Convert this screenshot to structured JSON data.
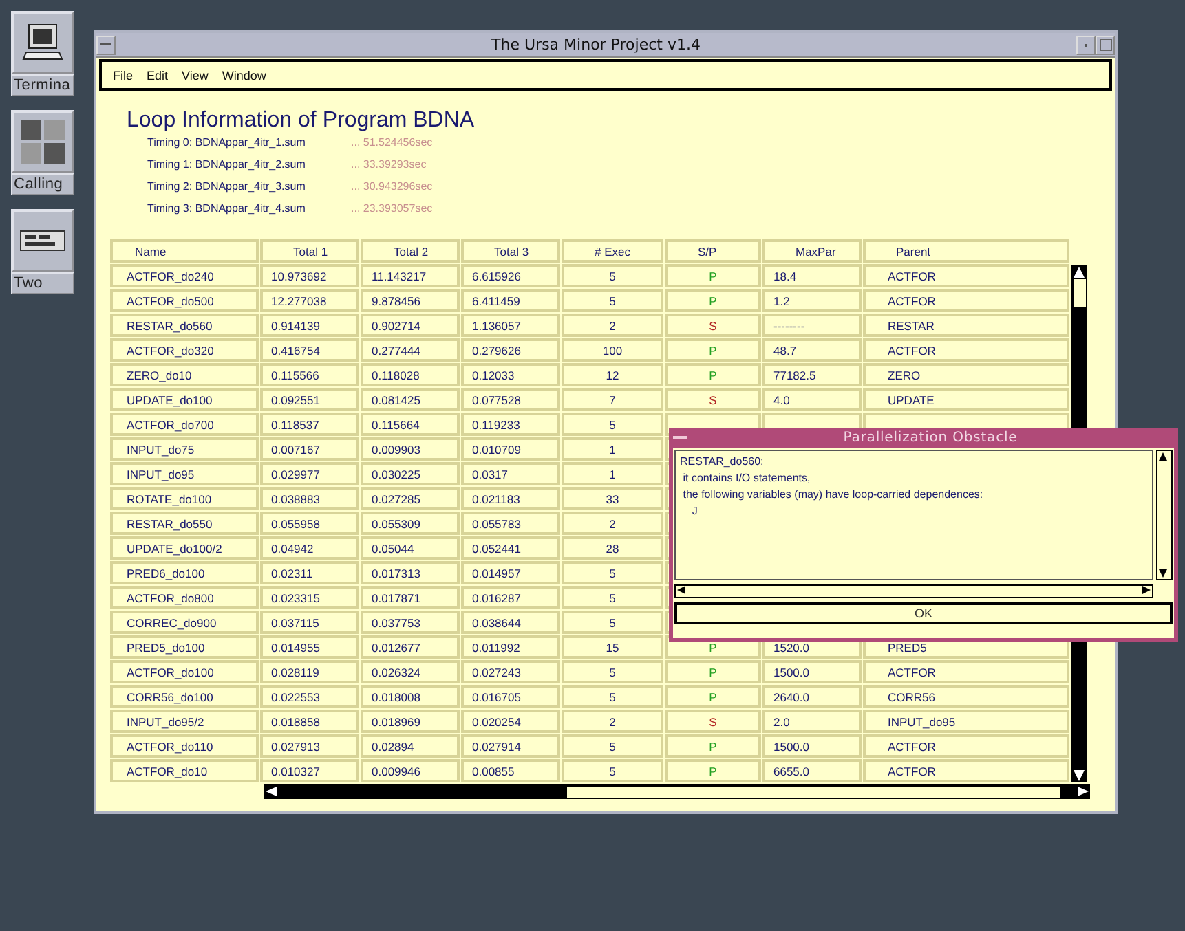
{
  "desktop_icons": [
    {
      "label": "Termina",
      "kind": "terminal"
    },
    {
      "label": "Calling",
      "kind": "grid"
    },
    {
      "label": "Two",
      "kind": "panel"
    }
  ],
  "window": {
    "title": "The Ursa Minor Project v1.4"
  },
  "menu": [
    "File",
    "Edit",
    "View",
    "Window"
  ],
  "heading": "Loop Information of Program BDNA",
  "timings": [
    {
      "label": "Timing 0: BDNAppar_4itr_1.sum",
      "value": "... 51.524456sec"
    },
    {
      "label": "Timing 1: BDNAppar_4itr_2.sum",
      "value": "... 33.39293sec"
    },
    {
      "label": "Timing 2: BDNAppar_4itr_3.sum",
      "value": "... 30.943296sec"
    },
    {
      "label": "Timing 3: BDNAppar_4itr_4.sum",
      "value": "... 23.393057sec"
    }
  ],
  "table": {
    "columns": [
      "Name",
      "Total 1",
      "Total 2",
      "Total 3",
      "# Exec",
      "S/P",
      "MaxPar",
      "Parent"
    ],
    "rows": [
      {
        "name": "ACTFOR_do240",
        "total1": "10.973692",
        "total2": "11.143217",
        "total3": "6.615926",
        "exec": "5",
        "sp": "P",
        "color": "#22a022",
        "maxpar": "18.4",
        "parent": "ACTFOR"
      },
      {
        "name": "ACTFOR_do500",
        "total1": "12.277038",
        "total2": "9.878456",
        "total3": "6.411459",
        "exec": "5",
        "sp": "P",
        "color": "#22a022",
        "maxpar": "1.2",
        "parent": "ACTFOR"
      },
      {
        "name": "RESTAR_do560",
        "total1": "0.914139",
        "total2": "0.902714",
        "total3": "1.136057",
        "exec": "2",
        "sp": "S",
        "color": "#b02020",
        "maxpar": "--------",
        "parent": "RESTAR"
      },
      {
        "name": "ACTFOR_do320",
        "total1": "0.416754",
        "total2": "0.277444",
        "total3": "0.279626",
        "exec": "100",
        "sp": "P",
        "color": "#22a022",
        "maxpar": "48.7",
        "parent": "ACTFOR"
      },
      {
        "name": "ZERO_do10",
        "total1": "0.115566",
        "total2": "0.118028",
        "total3": "0.12033",
        "exec": "12",
        "sp": "P",
        "color": "#22a022",
        "maxpar": "77182.5",
        "parent": "ZERO"
      },
      {
        "name": "UPDATE_do100",
        "total1": "0.092551",
        "total2": "0.081425",
        "total3": "0.077528",
        "exec": "7",
        "sp": "S",
        "color": "#b02020",
        "maxpar": "4.0",
        "parent": "UPDATE"
      },
      {
        "name": "ACTFOR_do700",
        "total1": "0.118537",
        "total2": "0.115664",
        "total3": "0.119233",
        "exec": "5"
      },
      {
        "name": "INPUT_do75",
        "total1": "0.007167",
        "total2": "0.009903",
        "total3": "0.010709",
        "exec": "1"
      },
      {
        "name": "INPUT_do95",
        "total1": "0.029977",
        "total2": "0.030225",
        "total3": "0.0317",
        "exec": "1"
      },
      {
        "name": "ROTATE_do100",
        "total1": "0.038883",
        "total2": "0.027285",
        "total3": "0.021183",
        "exec": "33"
      },
      {
        "name": "RESTAR_do550",
        "total1": "0.055958",
        "total2": "0.055309",
        "total3": "0.055783",
        "exec": "2"
      },
      {
        "name": "UPDATE_do100/2",
        "total1": "0.04942",
        "total2": "0.05044",
        "total3": "0.052441",
        "exec": "28"
      },
      {
        "name": "PRED6_do100",
        "total1": "0.02311",
        "total2": "0.017313",
        "total3": "0.014957",
        "exec": "5"
      },
      {
        "name": "ACTFOR_do800",
        "total1": "0.023315",
        "total2": "0.017871",
        "total3": "0.016287",
        "exec": "5"
      },
      {
        "name": "CORREC_do900",
        "total1": "0.037115",
        "total2": "0.037753",
        "total3": "0.038644",
        "exec": "5"
      },
      {
        "name": "PRED5_do100",
        "total1": "0.014955",
        "total2": "0.012677",
        "total3": "0.011992",
        "exec": "15",
        "sp": "P",
        "color": "#22a022",
        "maxpar": "1520.0",
        "parent": "PRED5"
      },
      {
        "name": "ACTFOR_do100",
        "total1": "0.028119",
        "total2": "0.026324",
        "total3": "0.027243",
        "exec": "5",
        "sp": "P",
        "color": "#22a022",
        "maxpar": "1500.0",
        "parent": "ACTFOR"
      },
      {
        "name": "CORR56_do100",
        "total1": "0.022553",
        "total2": "0.018008",
        "total3": "0.016705",
        "exec": "5",
        "sp": "P",
        "color": "#22a022",
        "maxpar": "2640.0",
        "parent": "CORR56"
      },
      {
        "name": "INPUT_do95/2",
        "total1": "0.018858",
        "total2": "0.018969",
        "total3": "0.020254",
        "exec": "2",
        "sp": "S",
        "color": "#b02020",
        "maxpar": "2.0",
        "parent": "INPUT_do95"
      },
      {
        "name": "ACTFOR_do110",
        "total1": "0.027913",
        "total2": "0.02894",
        "total3": "0.027914",
        "exec": "5",
        "sp": "P",
        "color": "#22a022",
        "maxpar": "1500.0",
        "parent": "ACTFOR"
      },
      {
        "name": "ACTFOR_do10",
        "total1": "0.010327",
        "total2": "0.009946",
        "total3": "0.00855",
        "exec": "5",
        "sp": "P",
        "color": "#22a022",
        "maxpar": "6655.0",
        "parent": "ACTFOR"
      }
    ]
  },
  "dialog": {
    "title": "Parallelization Obstacle",
    "lines": [
      "RESTAR_do560:",
      " it contains I/O statements,",
      " the following variables (may) have loop-carried dependences:",
      "    J"
    ],
    "button": "OK"
  }
}
